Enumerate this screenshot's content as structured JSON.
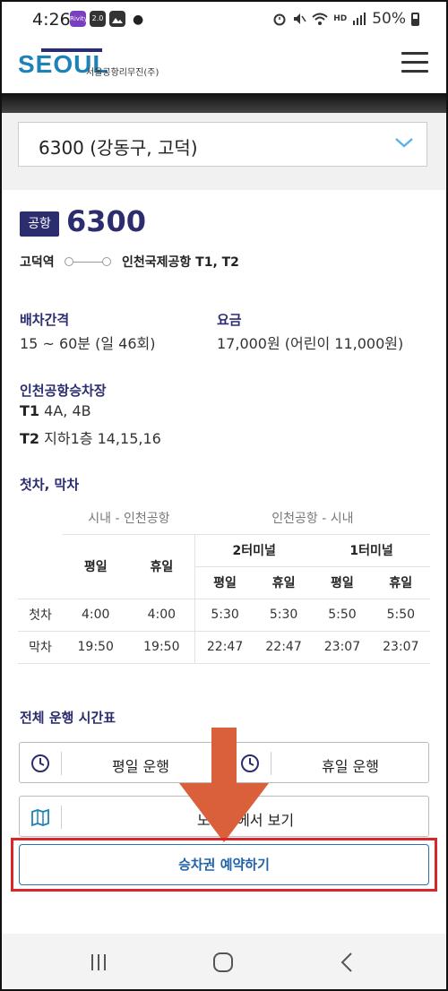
{
  "status": {
    "time": "4:26",
    "apps": [
      "Rivity",
      "2.0",
      "gallery"
    ],
    "icons": [
      "alarm-icon",
      "mute-icon",
      "wifi-icon",
      "hd-voice-icon",
      "signal-icon"
    ],
    "hd_label": "HD",
    "battery": "50%"
  },
  "header": {
    "logo": "SEOUL",
    "logo_sub": "서울공항리무진(주)"
  },
  "route_select": {
    "value": "6300 (강동구, 고덕)"
  },
  "route": {
    "badge": "공항",
    "number": "6300",
    "from": "고덕역",
    "to": "인천국제공항 T1, T2"
  },
  "info": {
    "interval_label": "배차간격",
    "interval_value": "15 ~ 60분 (일 46회)",
    "fare_label": "요금",
    "fare_value": "17,000원 (어린이 11,000원)",
    "boarding_label": "인천공항승차장",
    "t1_label": "T1",
    "t1_value": "4A, 4B",
    "t2_label": "T2",
    "t2_value": "지하1층 14,15,16"
  },
  "timetable": {
    "title": "첫차, 막차",
    "group_city": "시내 - 인천공항",
    "group_airport": "인천공항 - 시내",
    "weekday": "평일",
    "holiday": "휴일",
    "t2_terminal": "2터미널",
    "t1_terminal": "1터미널",
    "rows": [
      {
        "label": "첫차",
        "values": [
          "4:00",
          "4:00",
          "5:30",
          "5:30",
          "5:50",
          "5:50"
        ]
      },
      {
        "label": "막차",
        "values": [
          "19:50",
          "19:50",
          "22:47",
          "22:47",
          "23:07",
          "23:07"
        ]
      }
    ]
  },
  "schedule": {
    "title": "전체 운행 시간표",
    "weekday_btn": "평일 운행",
    "holiday_btn": "휴일 운행",
    "map_btn": "노선도에서 보기",
    "reserve_btn": "승차권 예약하기"
  },
  "colors": {
    "brand_navy": "#2b2d6e",
    "brand_blue": "#1d82b8",
    "highlight_red": "#d9262b",
    "arrow_orange": "#d9603a"
  }
}
